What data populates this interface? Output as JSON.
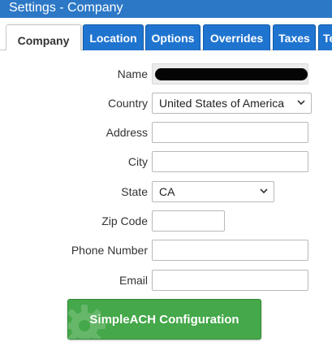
{
  "window": {
    "title": "Settings - Company"
  },
  "tabs": [
    {
      "label": "Company",
      "active": true
    },
    {
      "label": "Location"
    },
    {
      "label": "Options"
    },
    {
      "label": "Overrides"
    },
    {
      "label": "Taxes"
    },
    {
      "label": "Te"
    }
  ],
  "form": {
    "name": {
      "label": "Name",
      "value": ""
    },
    "country": {
      "label": "Country",
      "value": "United States of America"
    },
    "address": {
      "label": "Address",
      "value": ""
    },
    "city": {
      "label": "City",
      "value": ""
    },
    "state": {
      "label": "State",
      "value": "CA"
    },
    "zip": {
      "label": "Zip Code",
      "value": ""
    },
    "phone": {
      "label": "Phone Number",
      "value": ""
    },
    "email": {
      "label": "Email",
      "value": ""
    }
  },
  "actions": {
    "simpleach_label": "SimpleACH Configuration"
  },
  "icons": {
    "dropdown": "chevron-down-icon",
    "button_decoration": "gear-icon"
  },
  "colors": {
    "titlebar": "#2c78c6",
    "tab_inactive": "#1f74d0",
    "button_green": "#45a84a"
  }
}
